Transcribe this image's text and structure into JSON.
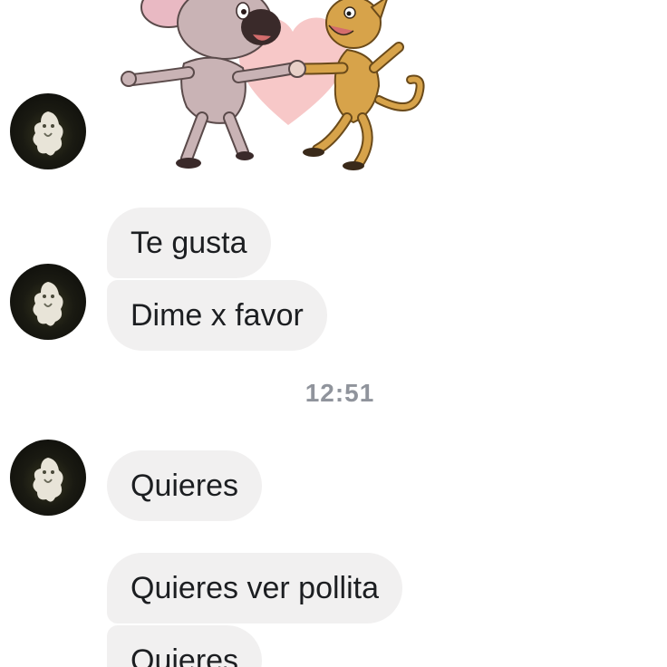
{
  "conversation": {
    "timestamp": "12:51",
    "messages": [
      {
        "text": "Te gusta"
      },
      {
        "text": "Dime x favor"
      },
      {
        "text": "Quieres"
      },
      {
        "text": "Quieres ver pollita"
      },
      {
        "text": "Quieres"
      }
    ]
  },
  "colors": {
    "bubble_bg": "#f1f0f0",
    "text": "#1c1e21",
    "timestamp": "#90949c"
  },
  "icons": {
    "sender_avatar": "avatar-icon",
    "sticker": "dancing-mouse-and-cat-sticker"
  }
}
